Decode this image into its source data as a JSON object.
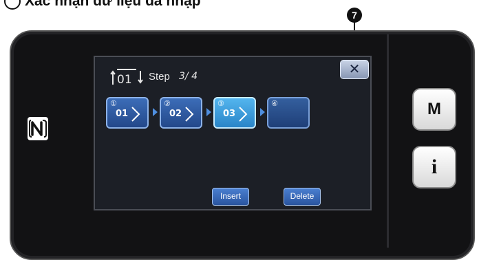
{
  "heading": {
    "text": "Xác nhận dữ liệu đã nhập"
  },
  "callout": {
    "number": "7"
  },
  "side_buttons": {
    "m_label": "M",
    "i_label": "i"
  },
  "step_header": {
    "icon": "step-cycle-icon",
    "label": "Step",
    "count": "3/ 4"
  },
  "close_button": {
    "label": "✕"
  },
  "steps": [
    {
      "num": "①",
      "code": "01",
      "state": "normal"
    },
    {
      "num": "②",
      "code": "02",
      "state": "normal"
    },
    {
      "num": "③",
      "code": "03",
      "state": "selected"
    },
    {
      "num": "④",
      "code": "",
      "state": "empty"
    }
  ],
  "actions": {
    "insert_label": "Insert",
    "delete_label": "Delete"
  },
  "colors": {
    "screen_bg": "#1c1f26",
    "tile": "#2f5ca8",
    "tile_selected": "#3aa0e6",
    "device": "#121214"
  }
}
